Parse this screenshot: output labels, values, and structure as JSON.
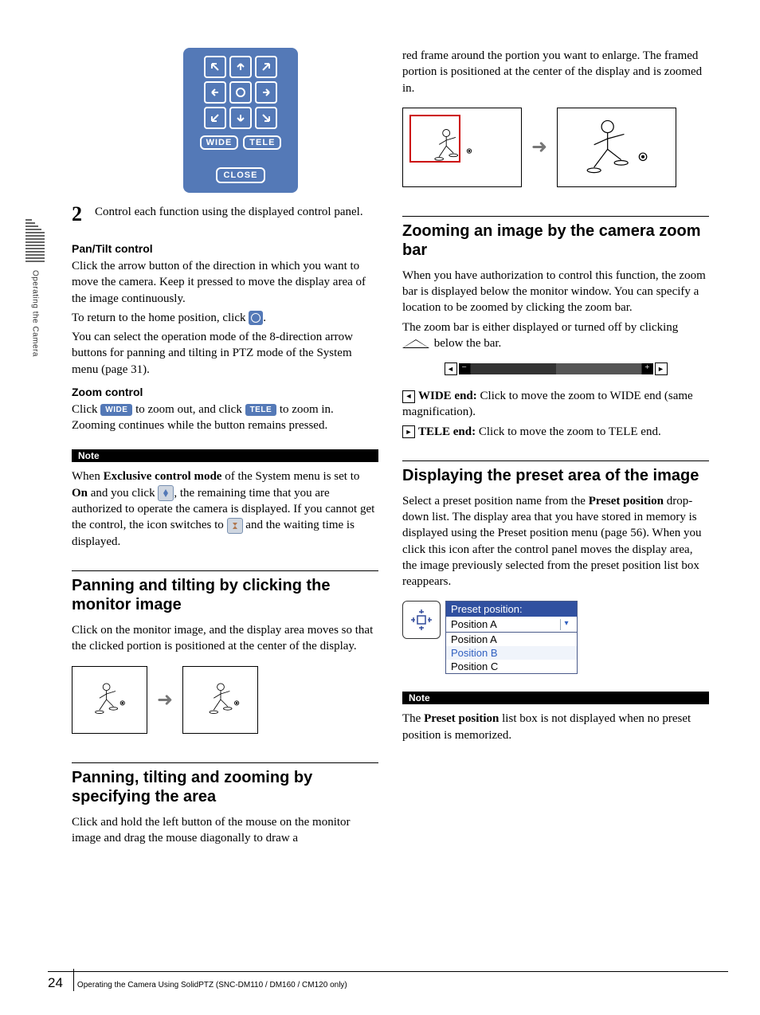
{
  "sidebar_label": "Operating the Camera",
  "panel": {
    "wide": "WIDE",
    "tele": "TELE",
    "close": "CLOSE"
  },
  "step2": {
    "num": "2",
    "text": "Control each function using the displayed control panel."
  },
  "pan": {
    "heading": "Pan/Tilt control",
    "p1a": "Click the arrow button of the direction in which you want to move the camera. Keep it pressed to move the display area of the image continuously.",
    "p2a": "To return to the home position, click ",
    "p2b": ".",
    "p3": "You can select the operation mode of the 8-direction arrow buttons for panning and tilting in PTZ mode of the System menu (page 31)."
  },
  "zoomctrl": {
    "heading": "Zoom control",
    "a": "Click ",
    "b": " to zoom out, and click ",
    "c": " to zoom in. Zooming continues while the button remains pressed.",
    "wide": "WIDE",
    "tele": "TELE"
  },
  "note1": {
    "label": "Note",
    "a": "When ",
    "b": "Exclusive control mode",
    "c": " of the System menu is set to ",
    "d": "On",
    "e": " and you click ",
    "f": ", the remaining time that you are authorized to operate the camera is displayed. If you cannot get the control, the icon switches to ",
    "g": " and the waiting time is displayed."
  },
  "sec_pan_click": {
    "heading": "Panning and tilting by clicking the monitor image",
    "p": "Click on the monitor image, and the display area moves so that the clicked portion is positioned at the center of the display."
  },
  "sec_ptz_area": {
    "heading": "Panning, tilting and zooming by specifying the area",
    "p": "Click and hold the left button of the mouse on the monitor image and drag the mouse diagonally to draw a"
  },
  "col2_top": "red frame around the portion you want to enlarge. The framed portion is positioned at the center of the display and is zoomed in.",
  "sec_zoombar": {
    "heading": "Zooming an image by the camera zoom bar",
    "p1": "When you have authorization to control this function, the zoom bar is displayed below the monitor window. You can specify a location to be zoomed by clicking the zoom bar.",
    "p2a": "The zoom bar is either displayed or turned off by clicking ",
    "p2b": " below the bar.",
    "wide_a": "WIDE end:",
    "wide_b": " Click to move the zoom to WIDE end (same magnification).",
    "tele_a": "TELE end:",
    "tele_b": " Click to move the zoom to TELE end."
  },
  "sec_preset": {
    "heading": "Displaying the preset area of the image",
    "p_a": "Select a preset position name from the ",
    "p_b": "Preset position",
    "p_c": " drop-down list. The display area that you have stored in memory is displayed using the Preset position menu (page 56). When you click this icon after the control panel moves the display area, the image previously selected from the preset position list box reappears.",
    "dropdown": {
      "label": "Preset position:",
      "selected": "Position A",
      "opts": [
        "Position A",
        "Position B",
        "Position C"
      ]
    }
  },
  "note2": {
    "label": "Note",
    "a": "The ",
    "b": "Preset position",
    "c": " list box is not displayed when no preset position is memorized."
  },
  "footer": {
    "page": "24",
    "text": "Operating the Camera Using SolidPTZ (SNC-DM110 / DM160 / CM120 only)"
  }
}
